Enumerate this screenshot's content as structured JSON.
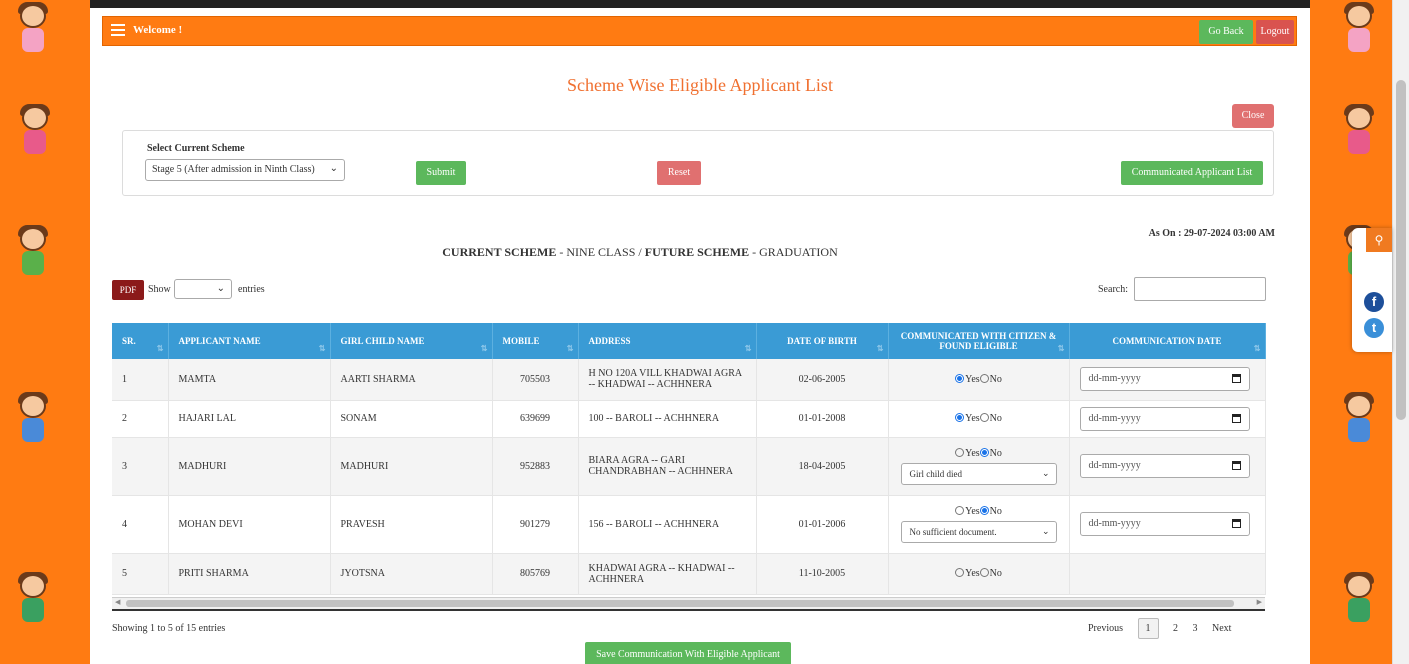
{
  "header": {
    "welcome": "Welcome !",
    "go_back": "Go Back",
    "logout": "Logout"
  },
  "title": "Scheme Wise Eligible Applicant List",
  "close_label": "Close",
  "scheme": {
    "label": "Select Current Scheme",
    "selected": "Stage 5 (After admission in Ninth Class)",
    "submit": "Submit",
    "reset": "Reset",
    "communicated_list": "Communicated Applicant List"
  },
  "as_on": "As On : 29-07-2024 03:00 AM",
  "scheme_line": {
    "current_label": "CURRENT SCHEME",
    "current_value": " - NINE CLASS / ",
    "future_label": "FUTURE SCHEME",
    "future_value": " - GRADUATION"
  },
  "table_controls": {
    "pdf": "PDF",
    "show": "Show",
    "entries": "entries",
    "search": "Search:"
  },
  "columns": [
    "SR.",
    "APPLICANT NAME",
    "GIRL CHILD NAME",
    "MOBILE",
    "ADDRESS",
    "DATE OF BIRTH",
    "COMMUNICATED WITH CITIZEN & FOUND ELIGIBLE",
    "COMMUNICATION DATE"
  ],
  "rows": [
    {
      "sr": "1",
      "applicant": "MAMTA",
      "girl": "AARTI SHARMA",
      "mobile": "705503",
      "address": "H NO 120A VILL KHADWAI AGRA -- KHADWAI -- ACHHNERA",
      "dob": "02-06-2005",
      "eligible": "Yes",
      "reason": "",
      "date_placeholder": "dd-mm-yyyy"
    },
    {
      "sr": "2",
      "applicant": "HAJARI LAL",
      "girl": "SONAM",
      "mobile": "639699",
      "address": "100 -- BAROLI -- ACHHNERA",
      "dob": "01-01-2008",
      "eligible": "Yes",
      "reason": "",
      "date_placeholder": "dd-mm-yyyy"
    },
    {
      "sr": "3",
      "applicant": "MADHURI",
      "girl": "MADHURI",
      "mobile": "952883",
      "address": "BIARA AGRA -- GARI CHANDRABHAN -- ACHHNERA",
      "dob": "18-04-2005",
      "eligible": "No",
      "reason": "Girl child died",
      "date_placeholder": "dd-mm-yyyy"
    },
    {
      "sr": "4",
      "applicant": "MOHAN DEVI",
      "girl": "PRAVESH",
      "mobile": "901279",
      "address": "156 -- BAROLI -- ACHHNERA",
      "dob": "01-01-2006",
      "eligible": "No",
      "reason": "No sufficient document.",
      "date_placeholder": "dd-mm-yyyy"
    },
    {
      "sr": "5",
      "applicant": "PRITI SHARMA",
      "girl": "JYOTSNA",
      "mobile": "805769",
      "address": "KHADWAI AGRA -- KHADWAI -- ACHHNERA",
      "dob": "11-10-2005",
      "eligible": "",
      "reason": "",
      "date_placeholder": ""
    }
  ],
  "radio_labels": {
    "yes": "Yes",
    "no": "No"
  },
  "footer": {
    "showing": "Showing 1 to 5 of 15 entries",
    "previous": "Previous",
    "pages": [
      "1",
      "2",
      "3"
    ],
    "next": "Next",
    "save": "Save Communication With Eligible Applicant"
  },
  "colors": {
    "border_orange": "#ff7b12",
    "title_orange": "#f07030",
    "table_header_blue": "#3a9bd5",
    "green_button": "#5cb85c",
    "red_button": "#d9534f"
  }
}
